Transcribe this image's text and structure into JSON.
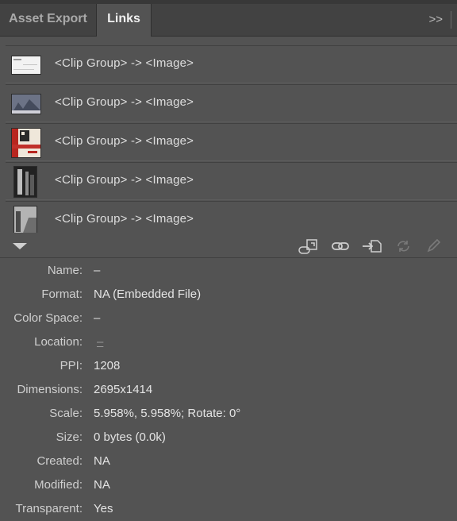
{
  "tabs": [
    {
      "label": "Asset Export",
      "active": false
    },
    {
      "label": "Links",
      "active": true
    }
  ],
  "panel_menu_glyph": ">>",
  "links": [
    {
      "label": "<Clip Group> -> <Image>",
      "thumbnail": "white-document-thumbnail"
    },
    {
      "label": "<Clip Group> -> <Image>",
      "thumbnail": "blue-gray-scene-thumbnail"
    },
    {
      "label": "<Clip Group> -> <Image>",
      "thumbnail": "red-poster-thumbnail"
    },
    {
      "label": "<Clip Group> -> <Image>",
      "thumbnail": "black-white-building-thumbnail"
    },
    {
      "label": "<Clip Group> -> <Image>",
      "thumbnail": "gray-street-thumbnail"
    }
  ],
  "toolbar_icons": [
    "relink-from-cc-icon",
    "go-to-link-icon",
    "embed-link-icon",
    "update-link-icon",
    "edit-original-icon"
  ],
  "info": [
    {
      "label": "Name:",
      "value": "–"
    },
    {
      "label": "Format:",
      "value": "NA (Embedded File)"
    },
    {
      "label": "Color Space:",
      "value": "–"
    },
    {
      "label": "Location:",
      "value": "–"
    },
    {
      "label": "PPI:",
      "value": "1208"
    },
    {
      "label": "Dimensions:",
      "value": "2695x1414"
    },
    {
      "label": "Scale:",
      "value": "5.958%, 5.958%; Rotate: 0°"
    },
    {
      "label": "Size:",
      "value": "0 bytes (0.0k)"
    },
    {
      "label": "Created:",
      "value": "NA"
    },
    {
      "label": "Modified:",
      "value": "NA"
    },
    {
      "label": "Transparent:",
      "value": "Yes"
    }
  ]
}
